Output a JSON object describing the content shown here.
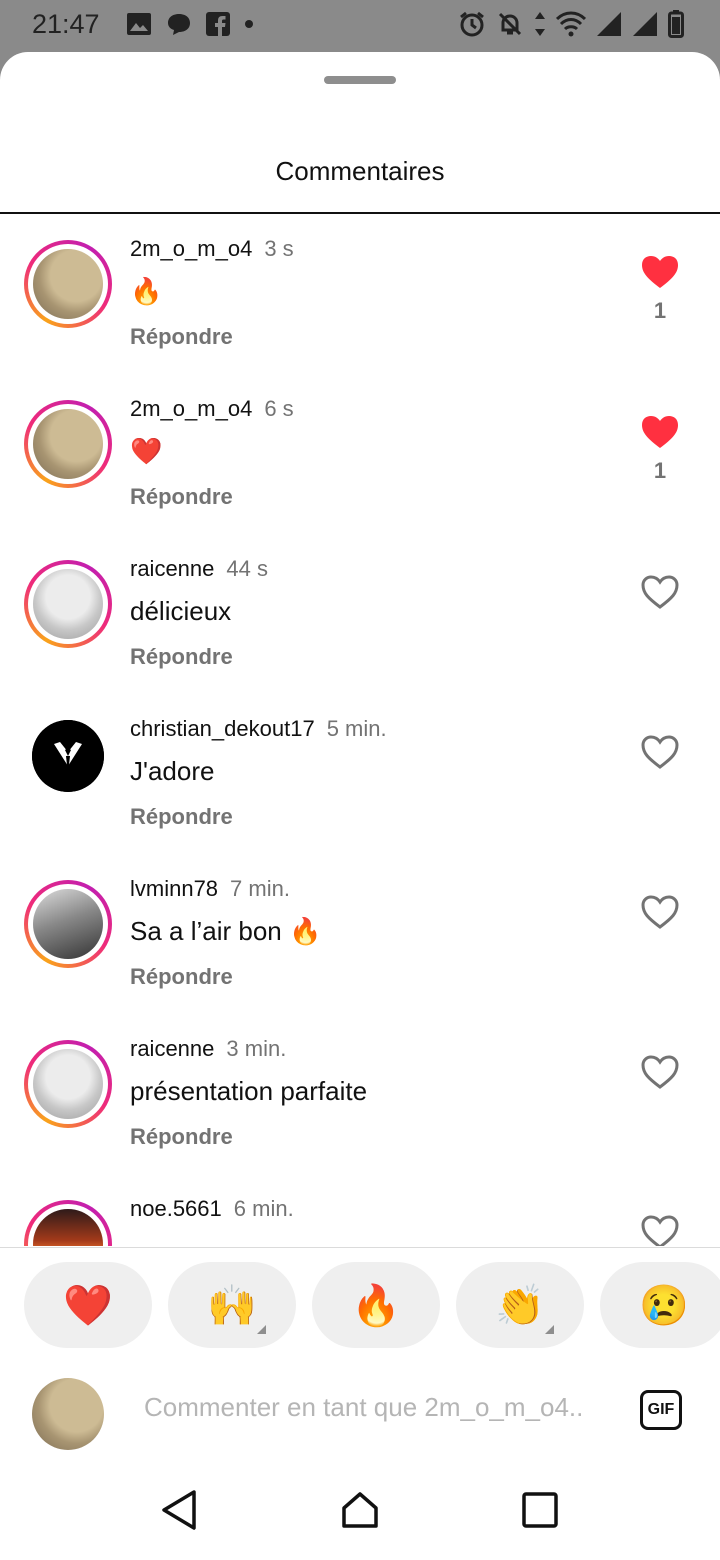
{
  "status_bar": {
    "time": "21:47",
    "left_icons": [
      "image-icon",
      "chat-bubble-icon",
      "facebook-icon",
      "dot-icon"
    ],
    "right_icons": [
      "alarm-icon",
      "bell-off-icon",
      "data-arrows-icon",
      "wifi-icon",
      "signal-icon",
      "signal-icon",
      "battery-icon"
    ]
  },
  "sheet": {
    "title": "Commentaires"
  },
  "comments": [
    {
      "user": "2m_o_m_o4",
      "time": "3 s",
      "text": "🔥",
      "reply": "Répondre",
      "liked": true,
      "likes": "1",
      "avatar": "pic-a",
      "ring": true
    },
    {
      "user": "2m_o_m_o4",
      "time": "6 s",
      "text": "❤️",
      "reply": "Répondre",
      "liked": true,
      "likes": "1",
      "avatar": "pic-a",
      "ring": true
    },
    {
      "user": "raicenne",
      "time": "44 s",
      "text": "délicieux",
      "reply": "Répondre",
      "liked": false,
      "likes": "",
      "avatar": "pic-b",
      "ring": true
    },
    {
      "user": "christian_dekout17",
      "time": "5 min.",
      "text": "J'adore",
      "reply": "Répondre",
      "liked": false,
      "likes": "",
      "avatar": "tuxedo",
      "ring": false
    },
    {
      "user": "lvminn78",
      "time": "7 min.",
      "text": "Sa a l’air bon 🔥",
      "reply": "Répondre",
      "liked": false,
      "likes": "",
      "avatar": "pic-c",
      "ring": true
    },
    {
      "user": "raicenne",
      "time": "3 min.",
      "text": "présentation parfaite",
      "reply": "Répondre",
      "liked": false,
      "likes": "",
      "avatar": "pic-b",
      "ring": true
    },
    {
      "user": "noe.5661",
      "time": "6 min.",
      "text": "",
      "reply": "",
      "liked": false,
      "likes": "",
      "avatar": "pic-d",
      "ring": true
    }
  ],
  "quick_reactions": [
    {
      "emoji": "❤️",
      "has_variants": false
    },
    {
      "emoji": "🙌",
      "has_variants": true
    },
    {
      "emoji": "🔥",
      "has_variants": false
    },
    {
      "emoji": "👏",
      "has_variants": true
    },
    {
      "emoji": "😢",
      "has_variants": false
    }
  ],
  "composer": {
    "placeholder": "Commenter en tant que 2m_o_m_o4..",
    "gif_label": "GIF"
  },
  "colors": {
    "like_red": "#ff3040",
    "muted_text": "#737373",
    "story_ring_start": "#f9a31b",
    "story_ring_end": "#c21fb0"
  }
}
